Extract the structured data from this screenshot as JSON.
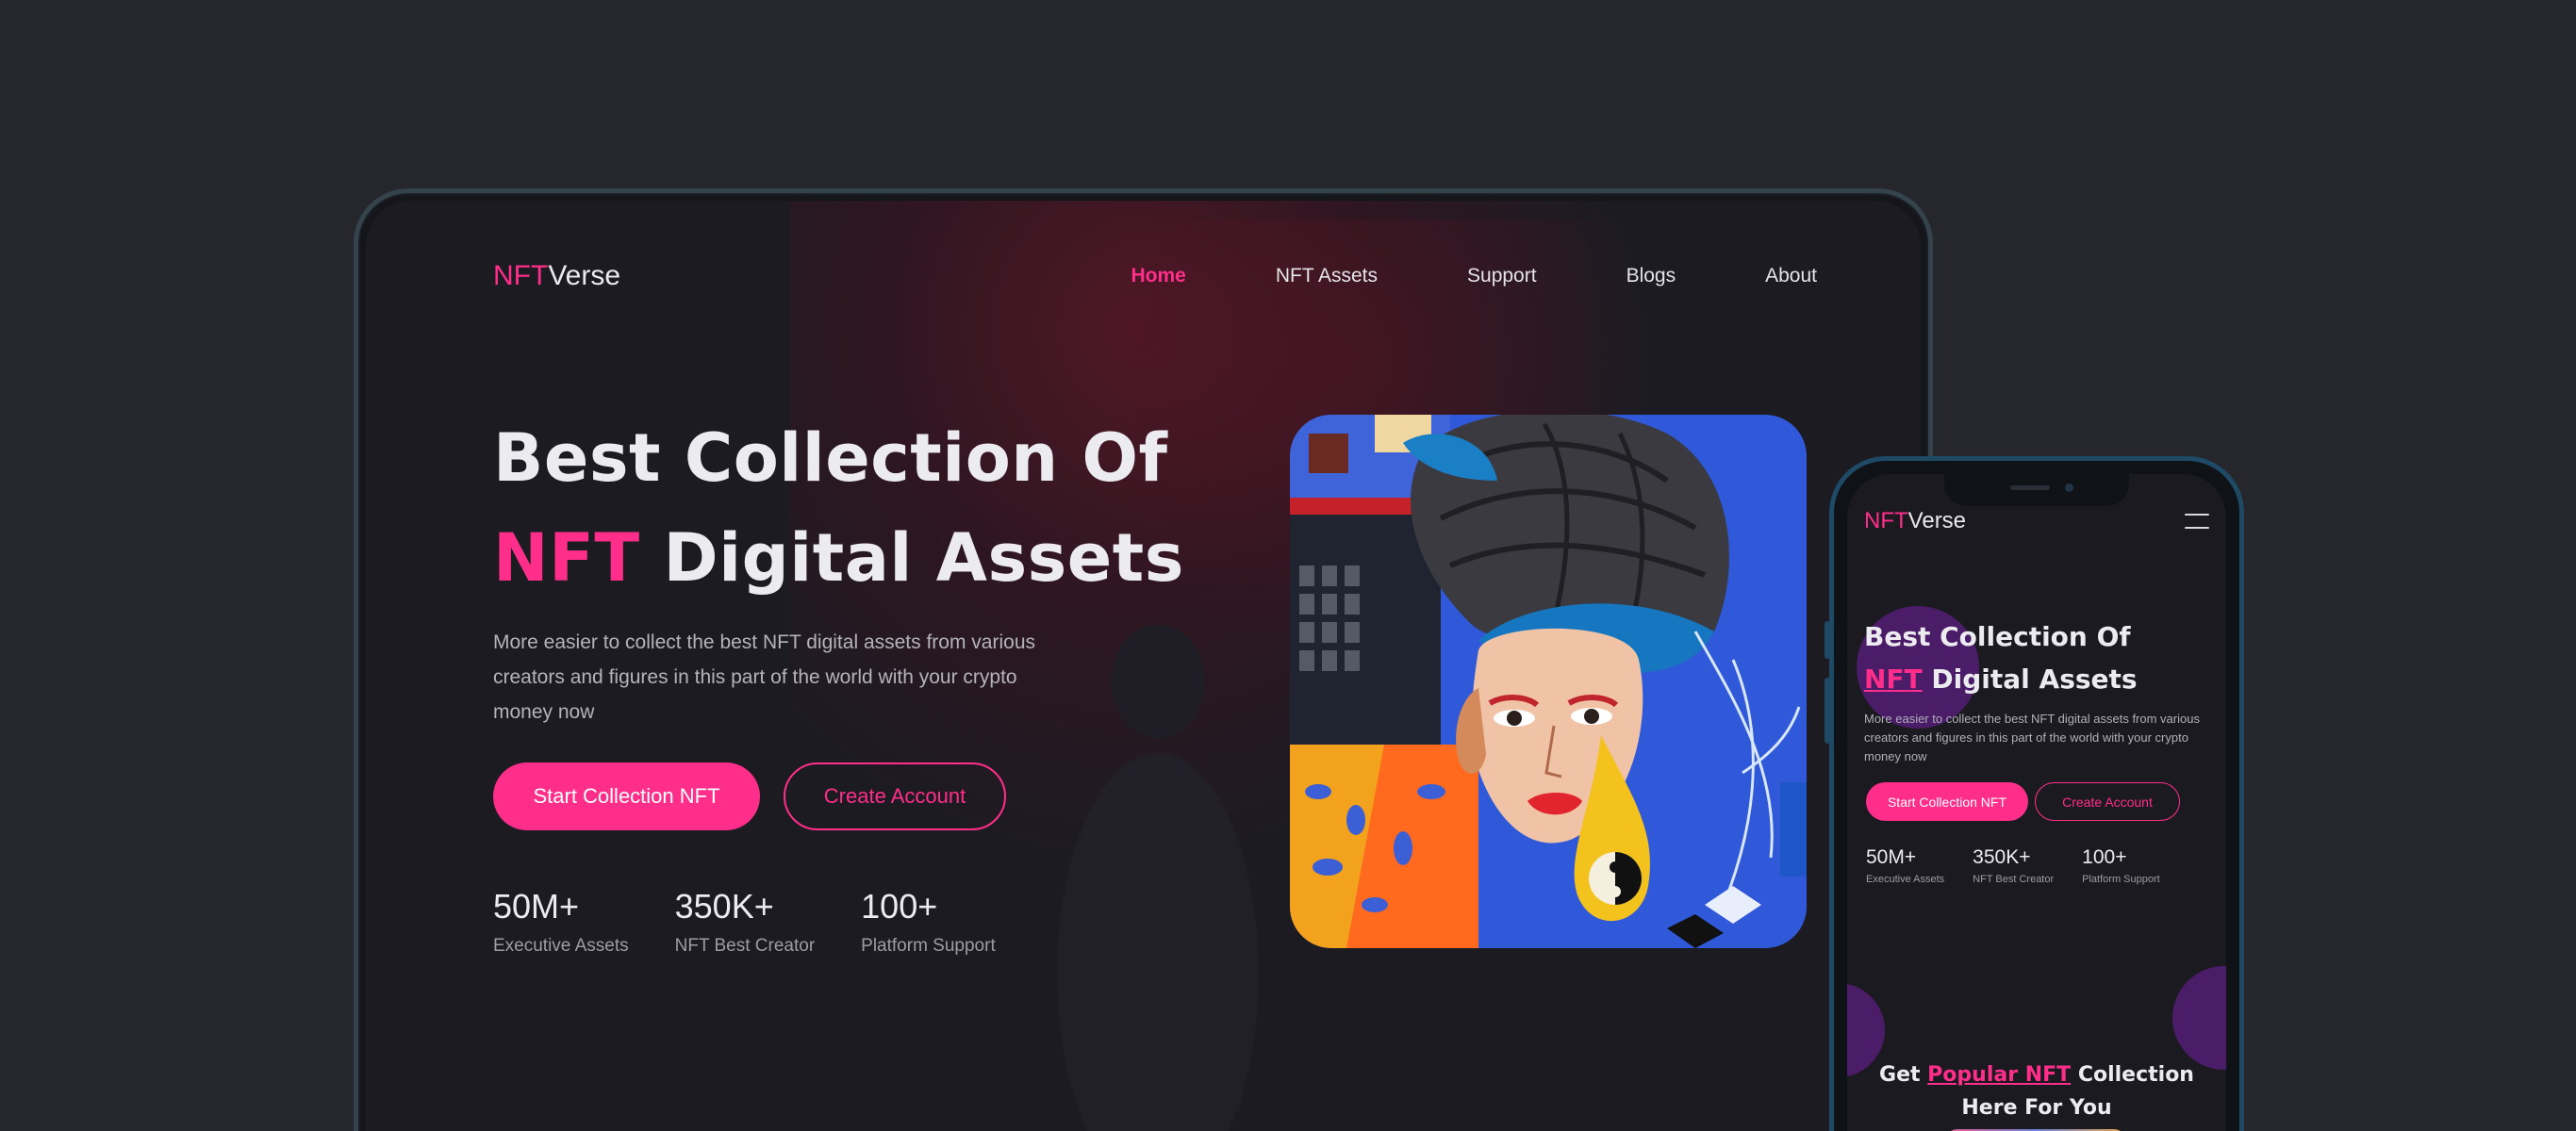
{
  "brand": {
    "prefix": "NFT",
    "suffix": "Verse"
  },
  "nav": {
    "items": [
      {
        "label": "Home",
        "active": true
      },
      {
        "label": "NFT Assets",
        "active": false
      },
      {
        "label": "Support",
        "active": false
      },
      {
        "label": "Blogs",
        "active": false
      },
      {
        "label": "About",
        "active": false
      }
    ]
  },
  "hero": {
    "title_line1": "Best Collection Of",
    "title_highlight": "NFT",
    "title_line2_rest": " Digital Assets",
    "description": "More easier to collect the best NFT digital assets from various creators and figures in this part of the world with your crypto money now",
    "primary_button": "Start Collection NFT",
    "secondary_button": "Create Account"
  },
  "stats": [
    {
      "value": "50M+",
      "label": "Executive Assets"
    },
    {
      "value": "350K+",
      "label": "NFT Best Creator"
    },
    {
      "value": "100+",
      "label": "Platform Support"
    }
  ],
  "mobile": {
    "section_title_pre": "Get ",
    "section_title_highlight": "Popular NFT",
    "section_title_post": " Collection",
    "section_title_line2": "Here For You"
  },
  "colors": {
    "accent": "#ff2e8a",
    "background": "#26272d",
    "screen": "#1c1b22",
    "blob": "#4b1c68"
  },
  "icons": [
    "hamburger-menu-icon"
  ]
}
